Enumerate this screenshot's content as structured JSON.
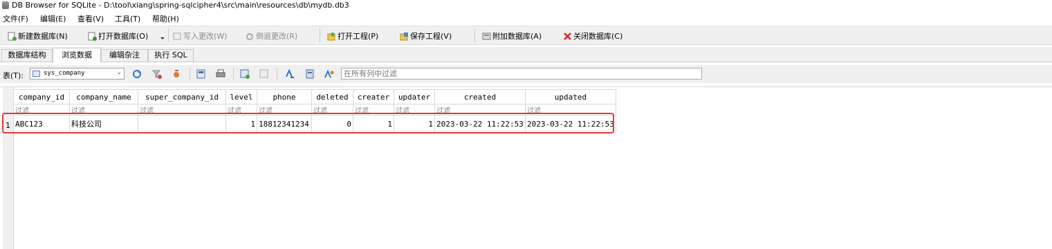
{
  "window": {
    "title": "DB Browser for SQLite - D:\\tool\\xiang\\spring-sqlcipher4\\src\\main\\resources\\db\\mydb.db3"
  },
  "menu": [
    "文件(F)",
    "编辑(E)",
    "查看(V)",
    "工具(T)",
    "帮助(H)"
  ],
  "toolbar": {
    "new_db": "新建数据库(N)",
    "open_db": "打开数据库(O)",
    "write_changes": "写入更改(W)",
    "revert_changes": "倒退更改(R)",
    "open_project": "打开工程(P)",
    "save_project": "保存工程(V)",
    "attach_db": "附加数据库(A)",
    "close_db": "关闭数据库(C)"
  },
  "tabs": [
    "数据库结构",
    "浏览数据",
    "编辑杂注",
    "执行 SQL"
  ],
  "active_tab": "浏览数据",
  "browse": {
    "table_label": "表(T):",
    "table_selected": "sys_company",
    "filter_placeholder": "在所有列中过滤"
  },
  "grid": {
    "columns": [
      "company_id",
      "company_name",
      "super_company_id",
      "level",
      "phone",
      "deleted",
      "creater",
      "updater",
      "created",
      "updated"
    ],
    "filter_text": "过滤",
    "rows": [
      {
        "row_number": "1",
        "cells": [
          "ABC123",
          "科技公司",
          "",
          "1",
          "18812341234",
          "0",
          "1",
          "1",
          "2023-03-22 11:22:53",
          "2023-03-22 11:22:53"
        ]
      }
    ]
  },
  "colors": {
    "highlight": "#e53935",
    "toolbar_bg": "#f0f0f0"
  }
}
